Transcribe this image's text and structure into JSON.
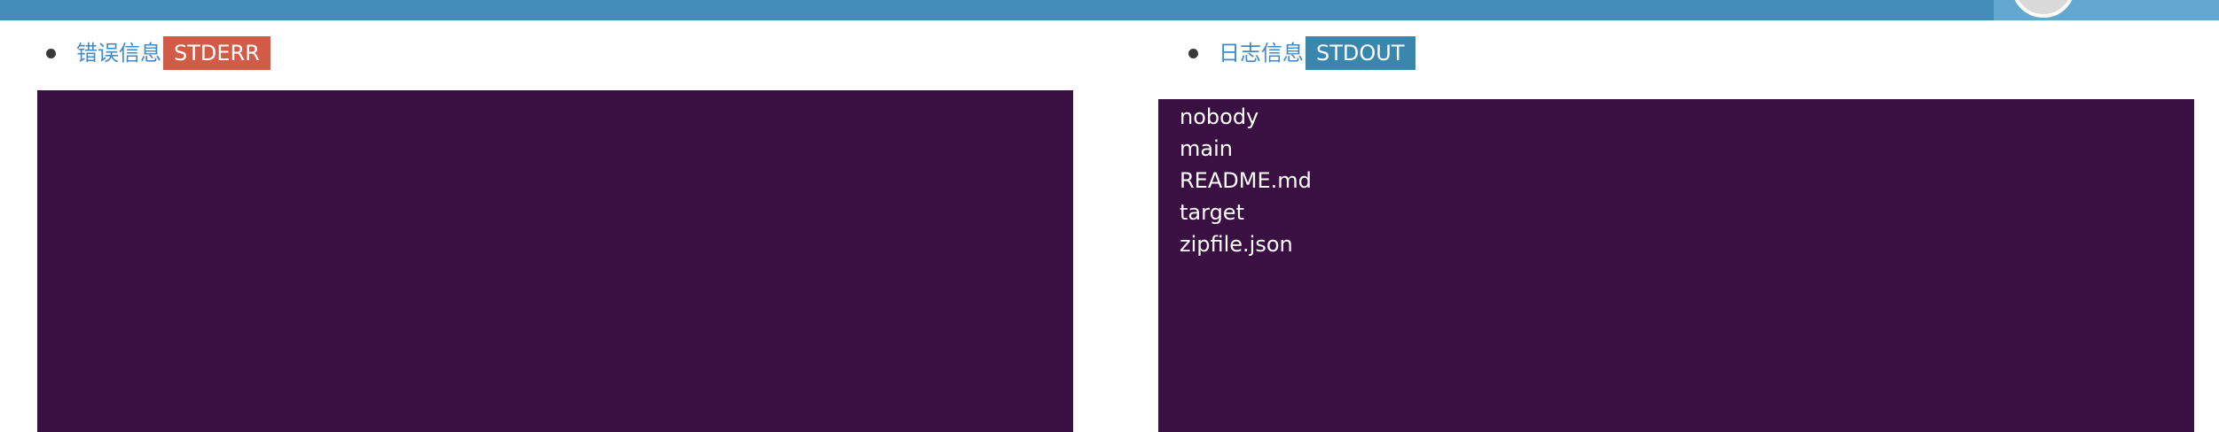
{
  "colors": {
    "topbar": "#438eb9",
    "user_area": "#62a8d1",
    "console_bg": "#3a1042",
    "stderr_badge": "#d15b47",
    "stdout_badge": "#3a87ad",
    "link": "#428bca"
  },
  "stderr_tab": {
    "label": "错误信息",
    "badge": "STDERR",
    "lines": []
  },
  "stdout_tab": {
    "label": "日志信息",
    "badge": "STDOUT",
    "lines": [
      "nobody",
      "main",
      "README.md",
      "target",
      "zipfile.json"
    ]
  }
}
